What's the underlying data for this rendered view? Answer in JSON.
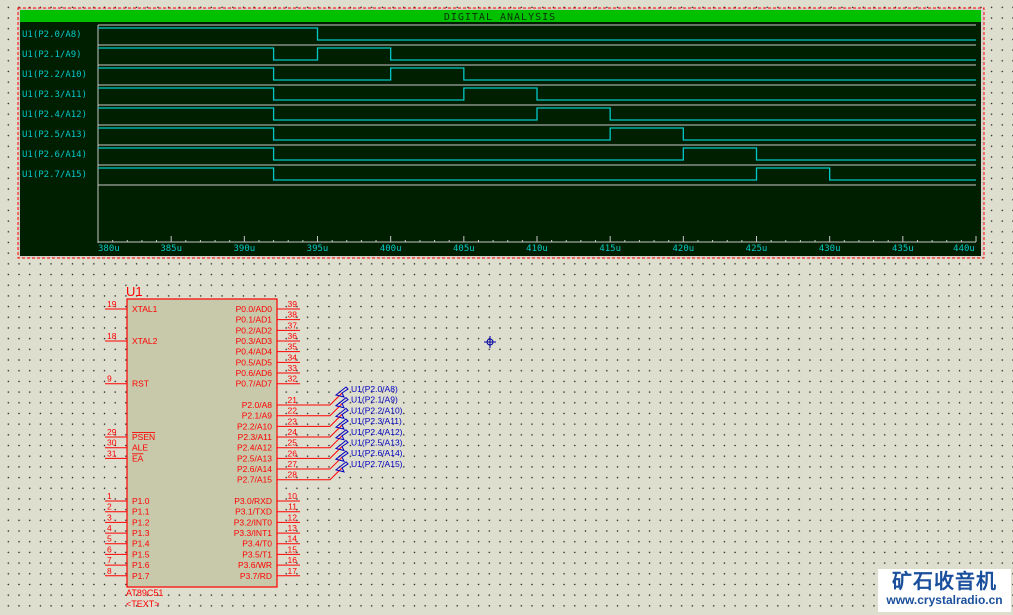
{
  "graph": {
    "title": "DIGITAL ANALYSIS",
    "time_unit": "u",
    "x_range": [
      380,
      440
    ],
    "ticks": [
      "380u",
      "385u",
      "390u",
      "395u",
      "400u",
      "405u",
      "410u",
      "415u",
      "420u",
      "425u",
      "430u",
      "435u",
      "440u"
    ],
    "colors": {
      "title_bar": "#00C000",
      "plot_bg": "#001E00",
      "trace": "#00C8C8",
      "grid": "#C8C8C8",
      "border": "#FF0000"
    },
    "traces": [
      {
        "label": "U1(P2.0/A8)",
        "waveform": [
          [
            380,
            1
          ],
          [
            395,
            0
          ]
        ]
      },
      {
        "label": "U1(P2.1/A9)",
        "waveform": [
          [
            380,
            1
          ],
          [
            392,
            0
          ],
          [
            395,
            1
          ],
          [
            400,
            0
          ]
        ]
      },
      {
        "label": "U1(P2.2/A10)",
        "waveform": [
          [
            380,
            1
          ],
          [
            392,
            0
          ],
          [
            400,
            1
          ],
          [
            405,
            0
          ]
        ]
      },
      {
        "label": "U1(P2.3/A11)",
        "waveform": [
          [
            380,
            1
          ],
          [
            392,
            0
          ],
          [
            405,
            1
          ],
          [
            410,
            0
          ]
        ]
      },
      {
        "label": "U1(P2.4/A12)",
        "waveform": [
          [
            380,
            1
          ],
          [
            392,
            0
          ],
          [
            410,
            1
          ],
          [
            415,
            0
          ]
        ]
      },
      {
        "label": "U1(P2.5/A13)",
        "waveform": [
          [
            380,
            1
          ],
          [
            392,
            0
          ],
          [
            415,
            1
          ],
          [
            420,
            0
          ]
        ]
      },
      {
        "label": "U1(P2.6/A14)",
        "waveform": [
          [
            380,
            1
          ],
          [
            392,
            0
          ],
          [
            420,
            1
          ],
          [
            425,
            0
          ]
        ]
      },
      {
        "label": "U1(P2.7/A15)",
        "waveform": [
          [
            380,
            1
          ],
          [
            392,
            0
          ],
          [
            425,
            1
          ],
          [
            430,
            0
          ]
        ]
      }
    ]
  },
  "chip": {
    "ref": "U1",
    "part": "AT89C51",
    "text": "<TEXT>",
    "colors": {
      "body": "#C8C8AA",
      "line": "#FF0000"
    },
    "left_pins": [
      {
        "num": "19",
        "name": "XTAL1",
        "slot": 0
      },
      {
        "num": "18",
        "name": "XTAL2",
        "slot": 3
      },
      {
        "num": "9",
        "name": "RST",
        "slot": 7
      },
      {
        "num": "29",
        "name": "PSEN",
        "slot": 12,
        "over": true
      },
      {
        "num": "30",
        "name": "ALE",
        "slot": 13
      },
      {
        "num": "31",
        "name": "EA",
        "slot": 14,
        "over": true
      },
      {
        "num": "1",
        "name": "P1.0",
        "slot": 18
      },
      {
        "num": "2",
        "name": "P1.1",
        "slot": 19
      },
      {
        "num": "3",
        "name": "P1.2",
        "slot": 20
      },
      {
        "num": "4",
        "name": "P1.3",
        "slot": 21
      },
      {
        "num": "5",
        "name": "P1.4",
        "slot": 22
      },
      {
        "num": "6",
        "name": "P1.5",
        "slot": 23
      },
      {
        "num": "7",
        "name": "P1.6",
        "slot": 24
      },
      {
        "num": "8",
        "name": "P1.7",
        "slot": 25
      }
    ],
    "right_pins": [
      {
        "num": "39",
        "name": "P0.0/AD0",
        "slot": 0
      },
      {
        "num": "38",
        "name": "P0.1/AD1",
        "slot": 1
      },
      {
        "num": "37",
        "name": "P0.2/AD2",
        "slot": 2
      },
      {
        "num": "36",
        "name": "P0.3/AD3",
        "slot": 3
      },
      {
        "num": "35",
        "name": "P0.4/AD4",
        "slot": 4
      },
      {
        "num": "34",
        "name": "P0.5/AD5",
        "slot": 5
      },
      {
        "num": "33",
        "name": "P0.6/AD6",
        "slot": 6
      },
      {
        "num": "32",
        "name": "P0.7/AD7",
        "slot": 7
      },
      {
        "num": "21",
        "name": "P2.0/A8",
        "slot": 9,
        "net": 0
      },
      {
        "num": "22",
        "name": "P2.1/A9",
        "slot": 10,
        "net": 1
      },
      {
        "num": "23",
        "name": "P2.2/A10",
        "slot": 11,
        "net": 2
      },
      {
        "num": "24",
        "name": "P2.3/A11",
        "slot": 12,
        "net": 3
      },
      {
        "num": "25",
        "name": "P2.4/A12",
        "slot": 13,
        "net": 4
      },
      {
        "num": "26",
        "name": "P2.5/A13",
        "slot": 14,
        "net": 5
      },
      {
        "num": "27",
        "name": "P2.6/A14",
        "slot": 15,
        "net": 6
      },
      {
        "num": "28",
        "name": "P2.7/A15",
        "slot": 16,
        "net": 7
      },
      {
        "num": "10",
        "name": "P3.0/RXD",
        "slot": 18
      },
      {
        "num": "11",
        "name": "P3.1/TXD",
        "slot": 19
      },
      {
        "num": "12",
        "name": "P3.2/INT0",
        "slot": 20
      },
      {
        "num": "13",
        "name": "P3.3/INT1",
        "slot": 21
      },
      {
        "num": "14",
        "name": "P3.4/T0",
        "slot": 22
      },
      {
        "num": "15",
        "name": "P3.5/T1",
        "slot": 23
      },
      {
        "num": "16",
        "name": "P3.6/WR",
        "slot": 24
      },
      {
        "num": "17",
        "name": "P3.7/RD",
        "slot": 25
      }
    ]
  },
  "net_labels": [
    "U1(P2.0/A8)",
    "U1(P2.1/A9)",
    "U1(P2.2/A10)",
    "U1(P2.3/A11)",
    "U1(P2.4/A12)",
    "U1(P2.5/A13)",
    "U1(P2.6/A14)",
    "U1(P2.7/A15)"
  ],
  "watermark": {
    "title": "矿石收音机",
    "url": "www.crystalradio.cn"
  }
}
